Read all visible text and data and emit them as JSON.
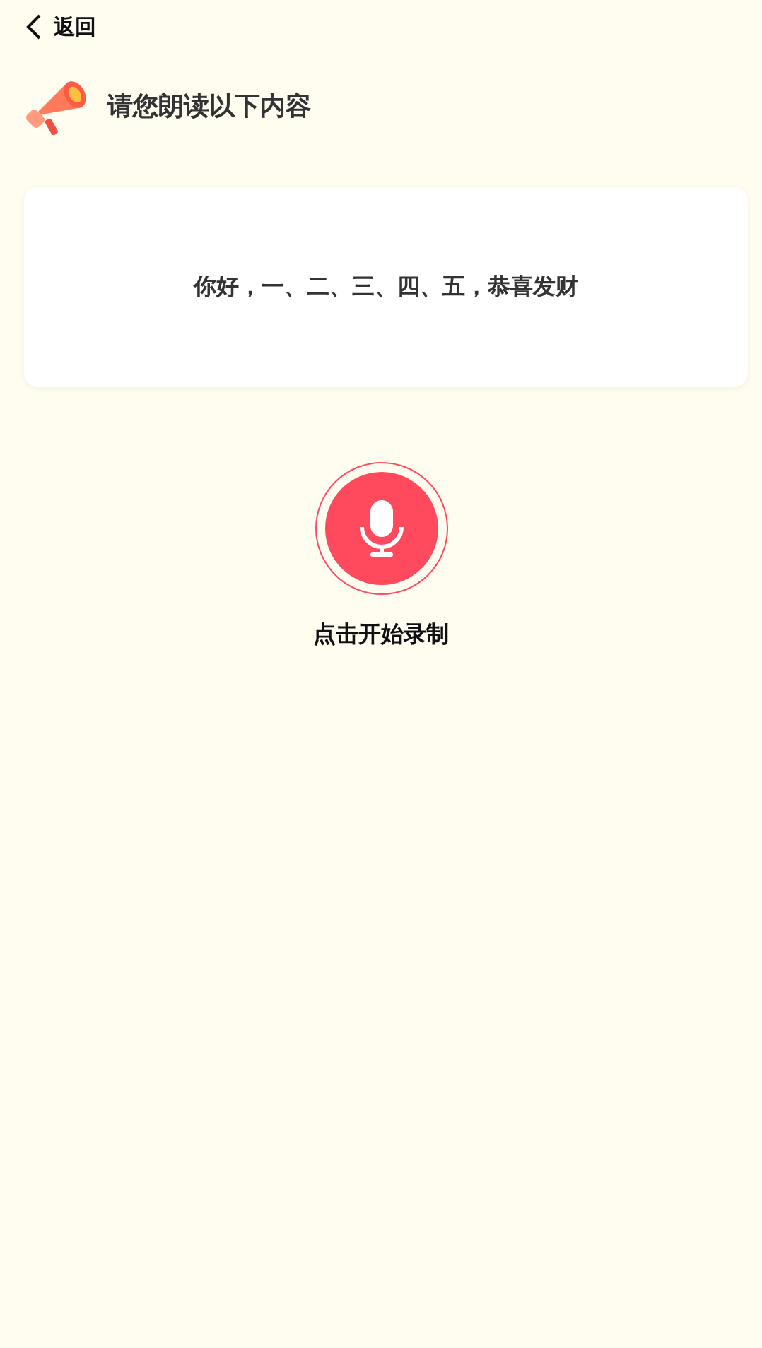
{
  "back": {
    "label": "返回"
  },
  "heading": "请您朗读以下内容",
  "prompt_text": "你好，一、二、三、四、五，恭喜发财",
  "record": {
    "label": "点击开始录制"
  }
}
